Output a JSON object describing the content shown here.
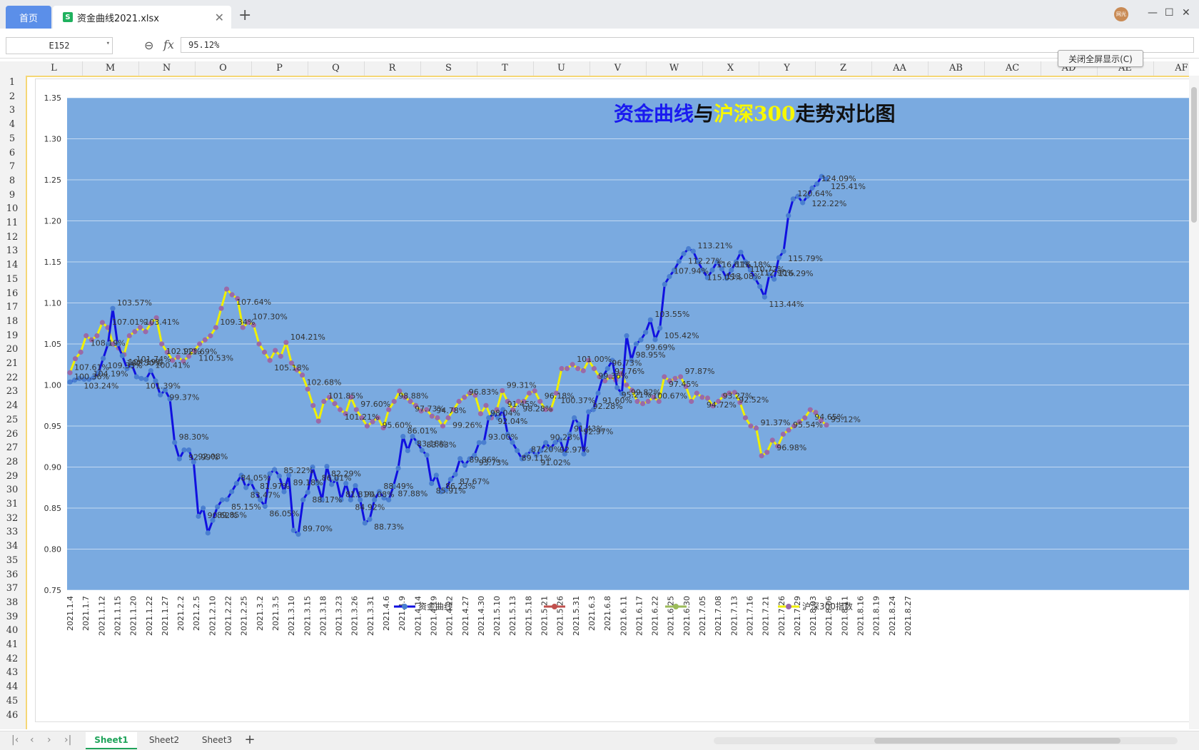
{
  "window": {
    "home_tab": "首页",
    "file_tab": "资金曲线2021.xlsx",
    "file_icon_letter": "S",
    "avatar_text": "网光"
  },
  "formula_bar": {
    "cell_ref": "E152",
    "value": "95.12%"
  },
  "exit_fullscreen_label": "关闭全屏显示(C)",
  "columns": [
    "L",
    "M",
    "N",
    "O",
    "P",
    "Q",
    "R",
    "S",
    "T",
    "U",
    "V",
    "W",
    "X",
    "Y",
    "Z",
    "AA",
    "AB",
    "AC",
    "AD",
    "AE",
    "AF"
  ],
  "rows": [
    "1",
    "2",
    "3",
    "4",
    "5",
    "6",
    "7",
    "8",
    "9",
    "10",
    "11",
    "12",
    "13",
    "14",
    "15",
    "16",
    "17",
    "18",
    "19",
    "20",
    "21",
    "22",
    "23",
    "24",
    "25",
    "26",
    "27",
    "28",
    "29",
    "30",
    "31",
    "32",
    "33",
    "34",
    "35",
    "36",
    "37",
    "38",
    "39",
    "40",
    "41",
    "42",
    "43",
    "44",
    "45",
    "46"
  ],
  "sheets": [
    "Sheet1",
    "Sheet2",
    "Sheet3"
  ],
  "active_sheet": "Sheet1",
  "colors": {
    "plot_bg": "#7aaae0",
    "fund_line": "#1010e0",
    "fund_marker": "#4a7fd0",
    "index_line": "#f0f000",
    "index_marker": "#9a6aa8",
    "series2": "#c0504d",
    "series3": "#9bbb59",
    "title_blue": "#1a1af0",
    "title_yellow": "#f8f800",
    "title_black": "#111111"
  },
  "chart_data": {
    "type": "line",
    "title_parts": [
      "资金曲线",
      "与",
      "沪深300",
      "走势对比图"
    ],
    "xlabel": "",
    "ylabel": "",
    "ylim": [
      0.75,
      1.35
    ],
    "yticks": [
      "1.35",
      "1.30",
      "1.25",
      "1.20",
      "1.15",
      "1.10",
      "1.05",
      "1.00",
      "0.95",
      "0.90",
      "0.85",
      "0.80",
      "0.75"
    ],
    "x_tick_labels": [
      "2021.1.4",
      "2021.1.7",
      "2021.1.12",
      "2021.1.15",
      "2021.1.20",
      "2021.1.22",
      "2021.1.27",
      "2021.2.2",
      "2021.2.5",
      "2021.2.10",
      "2021.2.22",
      "2021.2.25",
      "2021.3.2",
      "2021.3.5",
      "2021.3.10",
      "2021.3.15",
      "2021.3.18",
      "2021.3.23",
      "2021.3.26",
      "2021.3.31",
      "2021.4.6",
      "2021.4.9",
      "2021.4.14",
      "2021.4.19",
      "2021.4.22",
      "2021.4.27",
      "2021.4.30",
      "2021.5.10",
      "2021.5.13",
      "2021.5.18",
      "2021.5.21",
      "2021.5.26",
      "2021.5.31",
      "2021.6.3",
      "2021.6.8",
      "2021.6.11",
      "2021.6.17",
      "2021.6.22",
      "2021.6.25",
      "2021.6.30",
      "2021.7.05",
      "2021.7.08",
      "2021.7.13",
      "2021.7.16",
      "2021.7.21",
      "2021.7.26",
      "2021.7.29",
      "2021.8.03",
      "2021.8.06",
      "2021.8.11",
      "2021.8.16",
      "2021.8.19",
      "2021.8.24",
      "2021.8.27"
    ],
    "legend": [
      "资金曲线",
      "",
      "",
      "沪深300指数"
    ],
    "legend_position": "bottom",
    "grid": true,
    "series": [
      {
        "name": "资金曲线",
        "values": [
          1.0036,
          1.006,
          1.008,
          1.007,
          1.007,
          1.009,
          1.015,
          1.0324,
          1.05,
          1.0933,
          1.05,
          1.0357,
          1.02,
          1.025,
          1.01,
          1.008,
          1.007,
          1.0174,
          1.005,
          0.988,
          0.9937,
          0.983,
          0.9299,
          0.91,
          0.9208,
          0.9208,
          0.9062,
          0.84,
          0.85,
          0.8197,
          0.835,
          0.8515,
          0.86,
          0.8605,
          0.87,
          0.88,
          0.89,
          0.875,
          0.8818,
          0.87,
          0.8601,
          0.8522,
          0.8918,
          0.897,
          0.889,
          0.87,
          0.89,
          0.8229,
          0.8181,
          0.86,
          0.8692,
          0.9,
          0.88,
          0.86,
          0.9008,
          0.8788,
          0.8849,
          0.8601,
          0.88,
          0.86,
          0.8773,
          0.86,
          0.8318,
          0.8363,
          0.86,
          0.87,
          0.8623,
          0.86,
          0.8767,
          0.8986,
          0.9373,
          0.92,
          0.9374,
          0.93,
          0.9204,
          0.9145,
          0.88,
          0.89,
          0.87,
          0.872,
          0.885,
          0.8911,
          0.9102,
          0.9023,
          0.91,
          0.9143,
          0.9297,
          0.93,
          0.96,
          0.965,
          0.96,
          0.97,
          0.94,
          0.93,
          0.92,
          0.91,
          0.915,
          0.92,
          0.9145,
          0.92,
          0.9297,
          0.9228,
          0.93,
          0.9334,
          0.916,
          0.94,
          0.96,
          0.9521,
          0.916,
          0.9673,
          0.97,
          0.99,
          1.01,
          1.02,
          1.03,
          0.9969,
          0.9895,
          1.06,
          1.03,
          1.05,
          1.055,
          1.0642,
          1.0794,
          1.0553,
          1.0693,
          1.1227,
          1.1321,
          1.14,
          1.1505,
          1.16,
          1.1661,
          1.163,
          1.15,
          1.14,
          1.1308,
          1.14,
          1.15,
          1.1414,
          1.13,
          1.14,
          1.15,
          1.1618,
          1.15,
          1.14,
          1.13,
          1.12,
          1.1072,
          1.1344,
          1.129,
          1.1551,
          1.1629,
          1.2064,
          1.2266,
          1.23,
          1.2222,
          1.23,
          1.24,
          1.245,
          1.2541,
          1.2509
        ]
      },
      {
        "name": "沪深300指数",
        "values": [
          1.015,
          1.032,
          1.04,
          1.06,
          1.055,
          1.06,
          1.0761,
          1.07,
          1.05,
          1.045,
          1.037,
          1.06,
          1.065,
          1.0702,
          1.065,
          1.075,
          1.0819,
          1.05,
          1.04,
          1.03,
          1.0341,
          1.0292,
          1.035,
          1.0419,
          1.05,
          1.055,
          1.06,
          1.07,
          1.0934,
          1.1169,
          1.11,
          1.1053,
          1.0701,
          1.0764,
          1.073,
          1.05,
          1.04,
          1.03,
          1.0421,
          1.035,
          1.0518,
          1.0268,
          1.0185,
          1.0121,
          0.995,
          0.975,
          0.956,
          0.98,
          0.985,
          0.9773,
          0.97,
          0.965,
          0.985,
          0.97,
          0.96,
          0.95,
          0.9553,
          0.96,
          0.9478,
          0.97,
          0.98,
          0.9926,
          0.985,
          0.98,
          0.975,
          0.9683,
          0.97,
          0.962,
          0.96,
          0.95,
          0.96,
          0.97,
          0.98,
          0.985,
          0.99,
          0.9874,
          0.965,
          0.975,
          0.96,
          0.97,
          0.9931,
          0.98,
          0.97,
          0.98,
          0.98,
          0.99,
          0.9928,
          0.98,
          0.9702,
          0.97,
          0.99,
          1.02,
          1.02,
          1.025,
          1.02,
          1.0174,
          1.03,
          1.02,
          1.01,
          1.005,
          1.01,
          1.0059,
          1.0137,
          1.0,
          0.9936,
          0.98,
          0.9773,
          0.98,
          0.985,
          0.98,
          1.01,
          1.005,
          1.008,
          1.01,
          0.9982,
          0.98,
          0.99,
          0.985,
          0.984,
          0.9745,
          0.98,
          0.987,
          0.99,
          0.9909,
          0.9787,
          0.96,
          0.95,
          0.9475,
          0.9137,
          0.918,
          0.9327,
          0.9255,
          0.94,
          0.945,
          0.95,
          0.955,
          0.96,
          0.9698,
          0.9665,
          0.9565,
          0.9512
        ]
      }
    ],
    "data_labels_fund": [
      "100.36%",
      "103.24%",
      "104.19%",
      "109.33%",
      "103.57%",
      "102.50%",
      "101.74%",
      "101.39%",
      "100.41%",
      "99.37%",
      "98.30%",
      "92.99%",
      "92.08%",
      "90.62%",
      "89.85%",
      "85.15%",
      "84.05%",
      "83.47%",
      "81.97%",
      "86.05%",
      "85.22%",
      "89.18%",
      "89.70%",
      "88.17%",
      "86.01%",
      "82.29%",
      "81.81%",
      "84.92%",
      "90.08%",
      "88.73%",
      "88.49%",
      "87.88%",
      "86.01%",
      "83.18%",
      "83.63%",
      "85.91%",
      "86.23%",
      "87.67%",
      "89.86%",
      "93.73%",
      "93.00%",
      "92.04%",
      "91.45%",
      "89.11%",
      "87.20%",
      "91.02%",
      "90.23%",
      "92.97%",
      "91.43%",
      "92.97%",
      "92.28%",
      "91.60%",
      "96.73%",
      "95.21%",
      "98.95%",
      "99.69%",
      "103.55%",
      "105.42%",
      "107.94%",
      "112.27%",
      "113.21%",
      "115.05%",
      "116.61%",
      "113.08%",
      "116.18%",
      "110.72%",
      "112.90%",
      "113.44%",
      "116.29%",
      "115.79%",
      "120.64%",
      "122.22%",
      "124.09%",
      "125.41%"
    ],
    "data_labels_index": [
      "107.61%",
      "108.19%",
      "107.01%",
      "104.19%",
      "103.41%",
      "102.92%",
      "111.69%",
      "110.53%",
      "109.34%",
      "107.64%",
      "107.30%",
      "105.18%",
      "104.21%",
      "102.68%",
      "101.85%",
      "101.21%",
      "97.60%",
      "95.60%",
      "98.88%",
      "97.73%",
      "94.78%",
      "99.26%",
      "96.83%",
      "98.04%",
      "99.31%",
      "98.28%",
      "96.18%",
      "100.37%",
      "101.00%",
      "99.36%",
      "97.76%",
      "99.82%",
      "100.67%",
      "97.45%",
      "97.87%",
      "94.72%",
      "93.27%",
      "92.52%",
      "91.37%",
      "96.98%",
      "95.54%",
      "94.65%",
      "95.12%"
    ]
  }
}
